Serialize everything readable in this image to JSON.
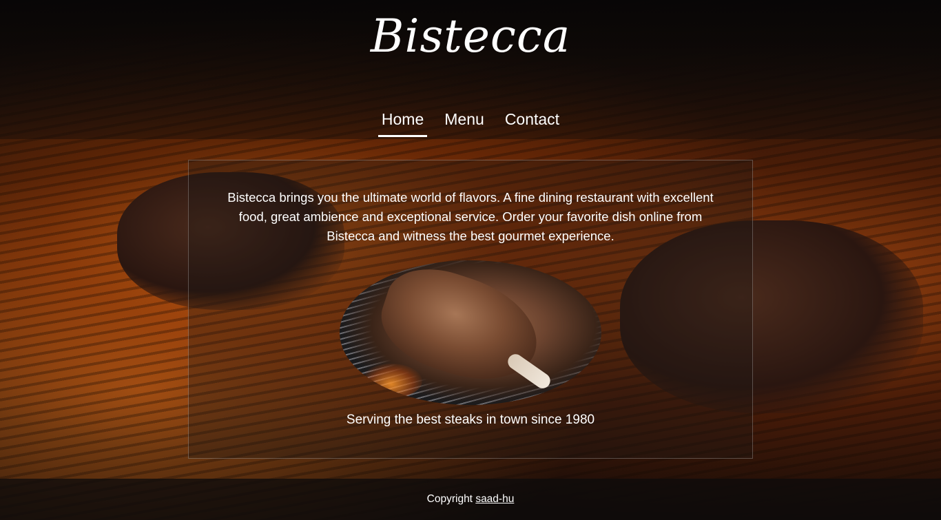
{
  "brand": {
    "name": "Bistecca"
  },
  "nav": {
    "items": [
      {
        "label": "Home",
        "active": true
      },
      {
        "label": "Menu",
        "active": false
      },
      {
        "label": "Contact",
        "active": false
      }
    ]
  },
  "main": {
    "intro": "Bistecca brings you the ultimate world of flavors. A fine dining restaurant with excellent food, great ambience and exceptional service. Order your favorite dish online from Bistecca and witness the best gourmet experience.",
    "tagline": "Serving the best steaks in town since 1980"
  },
  "footer": {
    "copyright_text": "Copyright",
    "author_link": "saad-hu"
  },
  "colors": {
    "text": "#ffffff",
    "accent_fire": "#ff8a1e"
  }
}
